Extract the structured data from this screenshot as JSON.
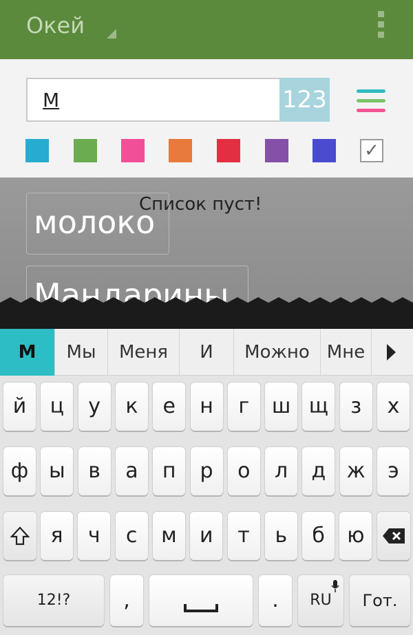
{
  "topbar": {
    "title": "Окей"
  },
  "input": {
    "value": "М",
    "num_button": "123"
  },
  "colors": {
    "topbar": "#5b8a3c",
    "swatches": [
      "#27acd0",
      "#6aac4f",
      "#f24f99",
      "#e87a3b",
      "#e23042",
      "#8450a8",
      "#4a4bd0"
    ],
    "menu_lines": [
      "#2fbcc2",
      "#7dc46a",
      "#f25592"
    ]
  },
  "list": {
    "empty_message": "Список пуст!",
    "items": [
      "молоко",
      "Мандарины"
    ]
  },
  "suggestions": [
    "М",
    "Мы",
    "Меня",
    "И",
    "Можно",
    "Мне"
  ],
  "keyboard": {
    "row1": [
      "й",
      "ц",
      "у",
      "к",
      "е",
      "н",
      "г",
      "ш",
      "щ",
      "з",
      "х"
    ],
    "row2": [
      "ф",
      "ы",
      "в",
      "а",
      "п",
      "р",
      "о",
      "л",
      "д",
      "ж",
      "э"
    ],
    "row3": [
      "я",
      "ч",
      "с",
      "м",
      "и",
      "т",
      "ь",
      "б",
      "ю"
    ],
    "symbols": "12!?",
    "comma": ",",
    "period": ".",
    "language": "RU",
    "done": "Гот."
  }
}
